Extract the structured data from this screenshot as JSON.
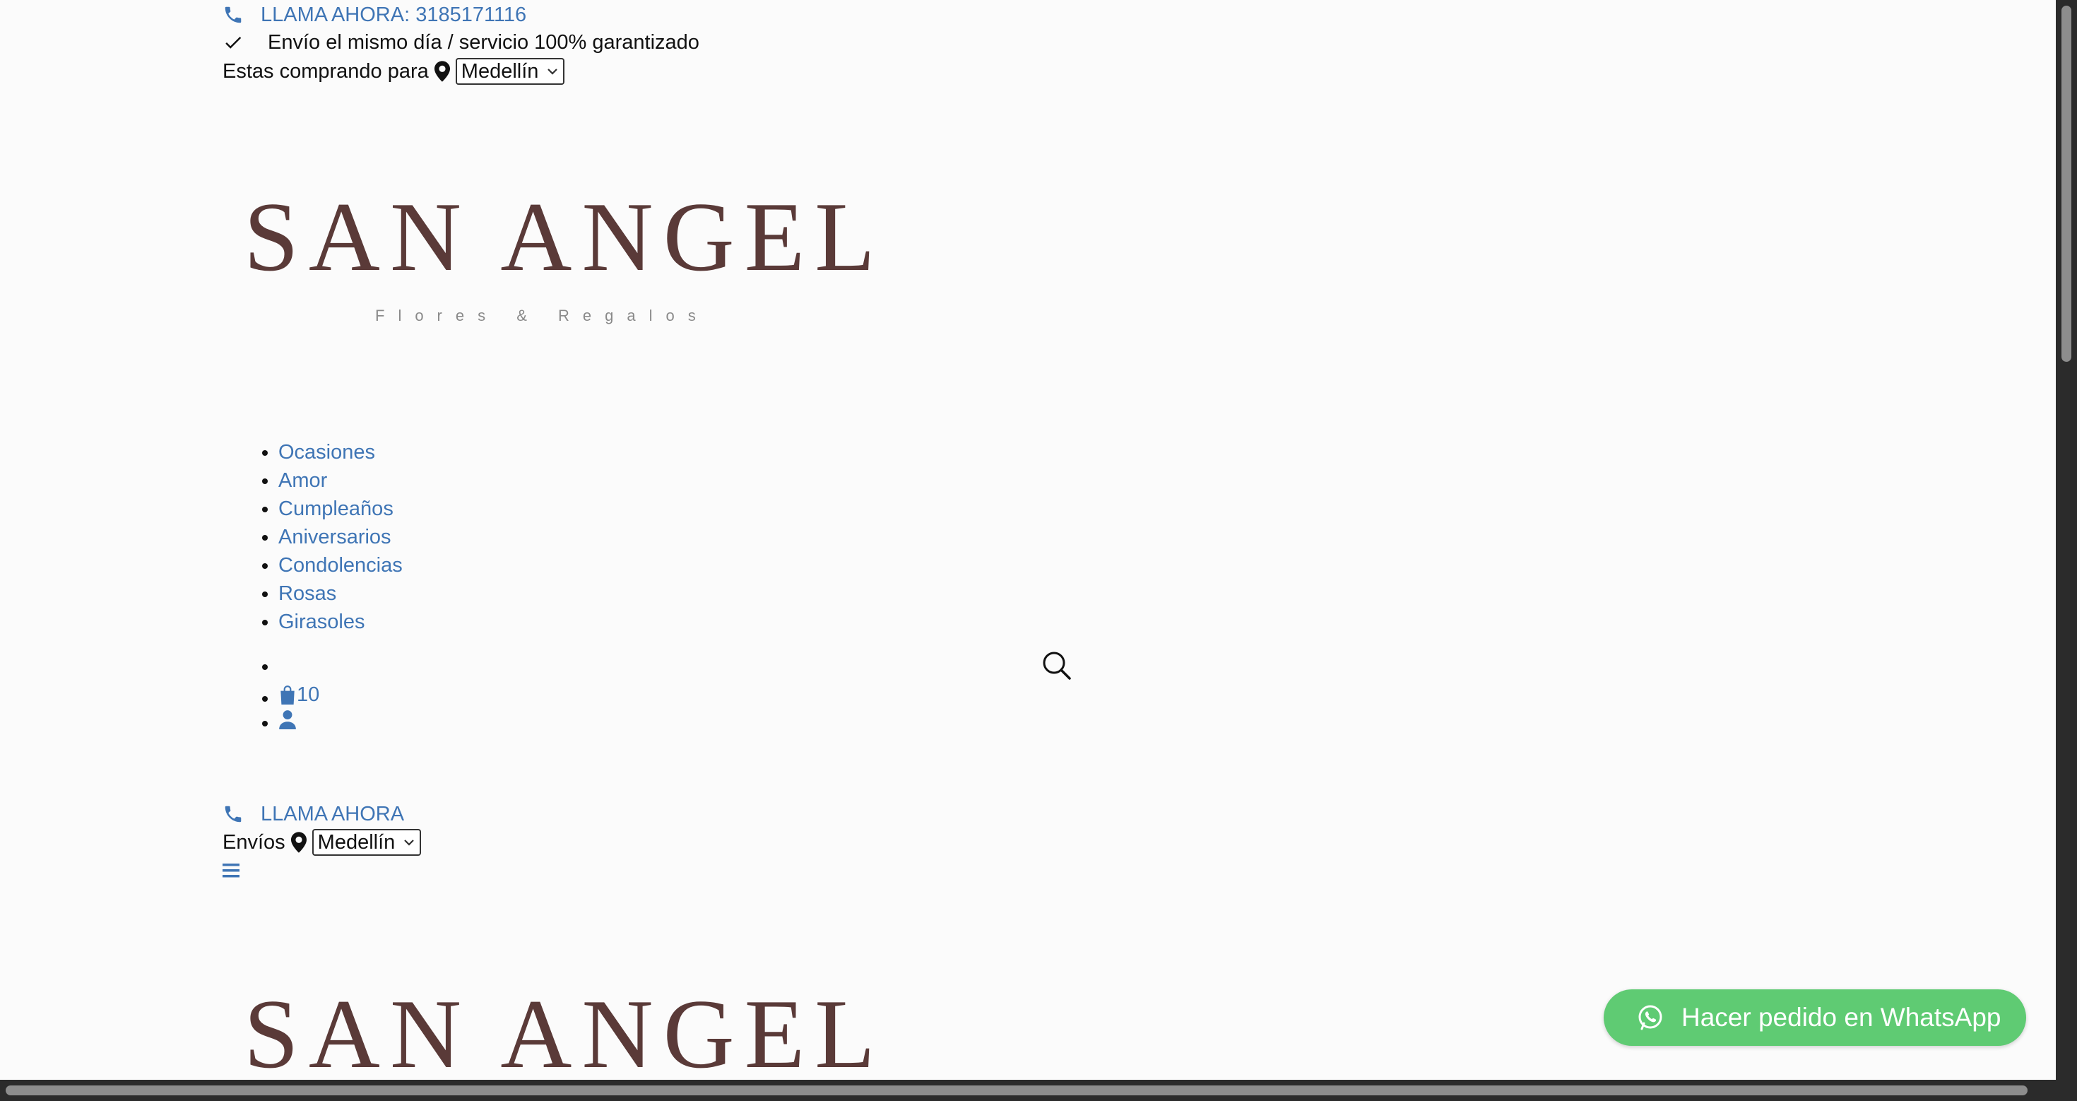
{
  "topbar": {
    "call_label": "LLAMA AHORA: 3185171116",
    "shipping_note": "Envío el mismo día / servicio 100% garantizado",
    "buying_for_label": "Estas comprando para",
    "city_selected": "Medellín"
  },
  "logo": {
    "brand": "SAN ANGEL",
    "tagline": "Flores & Regalos"
  },
  "menu": {
    "items": [
      {
        "label": "Ocasiones"
      },
      {
        "label": "Amor"
      },
      {
        "label": "Cumpleaños"
      },
      {
        "label": "Aniversarios"
      },
      {
        "label": "Condolencias"
      },
      {
        "label": "Rosas"
      },
      {
        "label": "Girasoles"
      }
    ]
  },
  "header_icons": {
    "search_icon": "search-icon",
    "cart_icon": "shopping-bag-icon",
    "cart_count": "10",
    "account_icon": "user-icon"
  },
  "mobile_header": {
    "call_label": "LLAMA AHORA",
    "shipping_label": "Envíos",
    "city_selected": "Medellín",
    "menu_icon": "hamburger-icon"
  },
  "whatsapp": {
    "label": "Hacer pedido en WhatsApp",
    "color": "#5fcb73"
  },
  "colors": {
    "link": "#3f75b5",
    "brand": "#5a3a38",
    "background": "#fbfbfb"
  }
}
